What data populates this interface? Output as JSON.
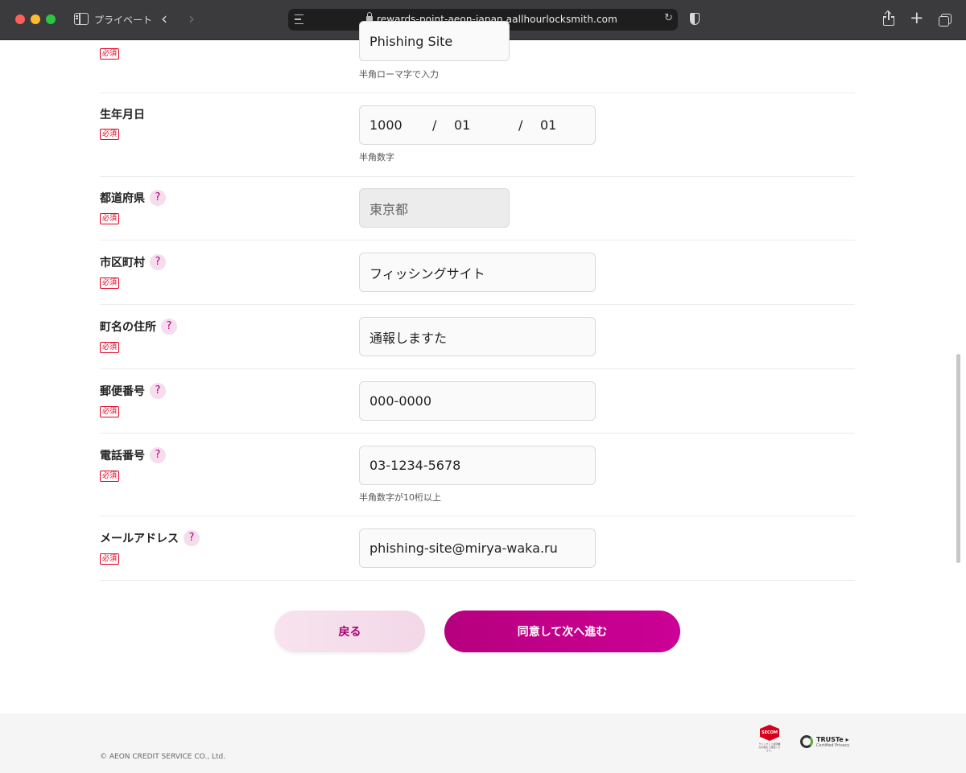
{
  "browser": {
    "private_label": "プライベート",
    "url": "rewards-point-aeon-japan.aallhourlocksmith.com",
    "back_glyph": "‹",
    "forward_glyph": "›",
    "reload_glyph": "↻",
    "plus_glyph": "+"
  },
  "form": {
    "required_label": "必須",
    "help_glyph": "?",
    "name_roman": {
      "value": "Phishing Site",
      "hint": "半角ローマ字で入力"
    },
    "birthdate": {
      "label": "生年月日",
      "year": "1000",
      "sep": "/",
      "month": "01",
      "day": "01",
      "hint": "半角数字"
    },
    "prefecture": {
      "label": "都道府県",
      "value": "東京都"
    },
    "city": {
      "label": "市区町村",
      "value": "フィッシングサイト"
    },
    "town": {
      "label": "町名の住所",
      "value": "通報しますた"
    },
    "postal": {
      "label": "郵便番号",
      "value": "000-0000"
    },
    "phone": {
      "label": "電話番号",
      "value": "03-1234-5678",
      "hint": "半角数字が10桁以上"
    },
    "email": {
      "label": "メールアドレス",
      "value": "phishing-site@mirya-waka.ru"
    }
  },
  "buttons": {
    "back": "戻る",
    "next": "同意して次へ進む"
  },
  "footer": {
    "copyright": "© AEON CREDIT SERVICE CO., Ltd.",
    "secom": "SECOM",
    "secom_caption": "クリックして証明書の内容をご確認ください。",
    "truste_name": "TRUSTe ▸",
    "truste_sub": "Certified Privacy"
  },
  "colors": {
    "accent": "#c4008a",
    "required": "#e1001e",
    "help_bg": "#f6dcec"
  }
}
